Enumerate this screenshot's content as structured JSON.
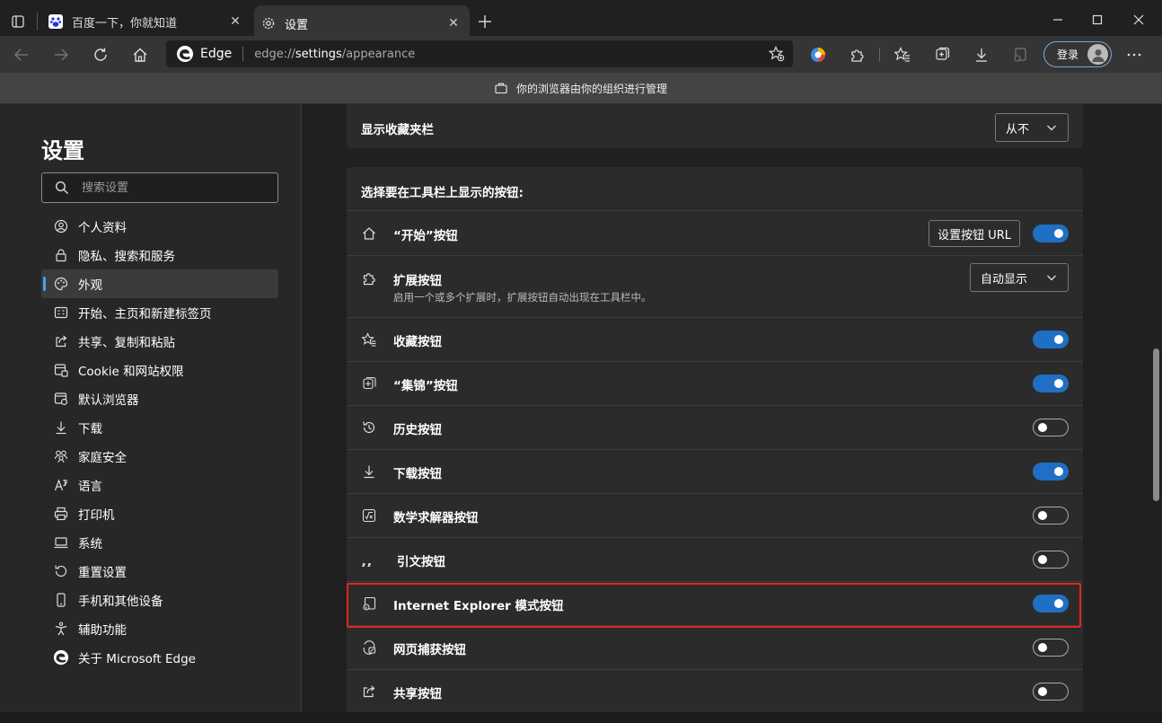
{
  "tabs": [
    {
      "title": "百度一下，你就知道",
      "active": false
    },
    {
      "title": "设置",
      "active": true
    }
  ],
  "omnibox": {
    "brand": "Edge",
    "url_prefix": "edge://",
    "url_host": "settings",
    "url_path": "/appearance"
  },
  "signin_label": "登录",
  "banner_text": "你的浏览器由你的组织进行管理",
  "sidebar": {
    "title": "设置",
    "search_placeholder": "搜索设置",
    "items": [
      {
        "label": "个人资料",
        "icon": "profile-icon"
      },
      {
        "label": "隐私、搜索和服务",
        "icon": "lock-icon"
      },
      {
        "label": "外观",
        "icon": "palette-icon",
        "active": true
      },
      {
        "label": "开始、主页和新建标签页",
        "icon": "start-page-icon"
      },
      {
        "label": "共享、复制和粘贴",
        "icon": "share-icon"
      },
      {
        "label": "Cookie 和网站权限",
        "icon": "site-permissions-icon"
      },
      {
        "label": "默认浏览器",
        "icon": "default-browser-icon"
      },
      {
        "label": "下载",
        "icon": "download-icon"
      },
      {
        "label": "家庭安全",
        "icon": "family-icon"
      },
      {
        "label": "语言",
        "icon": "language-icon"
      },
      {
        "label": "打印机",
        "icon": "printer-icon"
      },
      {
        "label": "系统",
        "icon": "system-icon"
      },
      {
        "label": "重置设置",
        "icon": "reset-icon"
      },
      {
        "label": "手机和其他设备",
        "icon": "phone-icon"
      },
      {
        "label": "辅助功能",
        "icon": "accessibility-icon"
      },
      {
        "label": "关于 Microsoft Edge",
        "icon": "edge-logo-icon"
      }
    ]
  },
  "favorites_bar": {
    "label": "显示收藏夹栏",
    "value": "从不"
  },
  "toolbar_section": {
    "title": "选择要在工具栏上显示的按钮:",
    "rows": [
      {
        "label": "“开始”按钮",
        "icon": "home-icon",
        "toggle": true,
        "url_button": "设置按钮 URL"
      },
      {
        "label": "扩展按钮",
        "icon": "extensions-icon",
        "dropdown": "自动显示",
        "subtitle": "启用一个或多个扩展时，扩展按钮自动出现在工具栏中。"
      },
      {
        "label": "收藏按钮",
        "icon": "favorites-icon",
        "toggle": true
      },
      {
        "label": "“集锦”按钮",
        "icon": "collections-icon",
        "toggle": true
      },
      {
        "label": "历史按钮",
        "icon": "history-icon",
        "toggle": false
      },
      {
        "label": "下载按钮",
        "icon": "download-icon",
        "toggle": true
      },
      {
        "label": "数学求解器按钮",
        "icon": "math-solver-icon",
        "toggle": false
      },
      {
        "label": "引文按钮",
        "icon": "citation-icon",
        "toggle": false
      },
      {
        "label": "Internet Explorer 模式按钮",
        "icon": "ie-mode-icon",
        "toggle": true
      },
      {
        "label": "网页捕获按钮",
        "icon": "web-capture-icon",
        "toggle": false
      },
      {
        "label": "共享按钮",
        "icon": "share-icon",
        "toggle": false
      }
    ]
  },
  "colors": {
    "accent": "#1f6fc4",
    "highlight": "#e0261e",
    "card": "#2b2b2b",
    "background": "#202020"
  }
}
